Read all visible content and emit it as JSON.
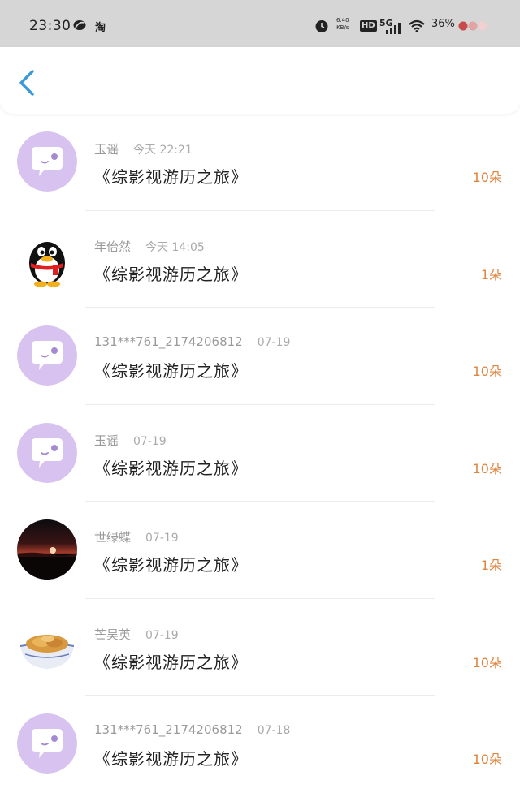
{
  "status_bar": {
    "time": "23:30",
    "app_label": "淘",
    "net_speed_value": "6.40",
    "net_speed_unit": "KB/s",
    "hd": "HD",
    "network": "5G",
    "battery": "36%"
  },
  "header": {
    "back_icon": "chevron-left-icon"
  },
  "colors": {
    "accent": "#e0843e",
    "default_avatar": "#d7c2f0",
    "back": "#3a9ad9"
  },
  "rows": [
    {
      "name": "玉谣",
      "date": "今天 22:21",
      "title": "《综影视游历之旅》",
      "amount": "10朵",
      "avatar": "default-chat-avatar"
    },
    {
      "name": "年佁然",
      "date": "今天 14:05",
      "title": "《综影视游历之旅》",
      "amount": "1朵",
      "avatar": "qq-penguin-avatar"
    },
    {
      "name": "131***761_2174206812",
      "date": "07-19",
      "title": "《综影视游历之旅》",
      "amount": "10朵",
      "avatar": "default-chat-avatar"
    },
    {
      "name": "玉谣",
      "date": "07-19",
      "title": "《综影视游历之旅》",
      "amount": "10朵",
      "avatar": "default-chat-avatar"
    },
    {
      "name": "世绿蝶",
      "date": "07-19",
      "title": "《综影视游历之旅》",
      "amount": "1朵",
      "avatar": "sunset-photo-avatar"
    },
    {
      "name": "芒昊英",
      "date": "07-19",
      "title": "《综影视游历之旅》",
      "amount": "10朵",
      "avatar": "food-bowl-avatar"
    },
    {
      "name": "131***761_2174206812",
      "date": "07-18",
      "title": "《综影视游历之旅》",
      "amount": "10朵",
      "avatar": "default-chat-avatar"
    }
  ]
}
